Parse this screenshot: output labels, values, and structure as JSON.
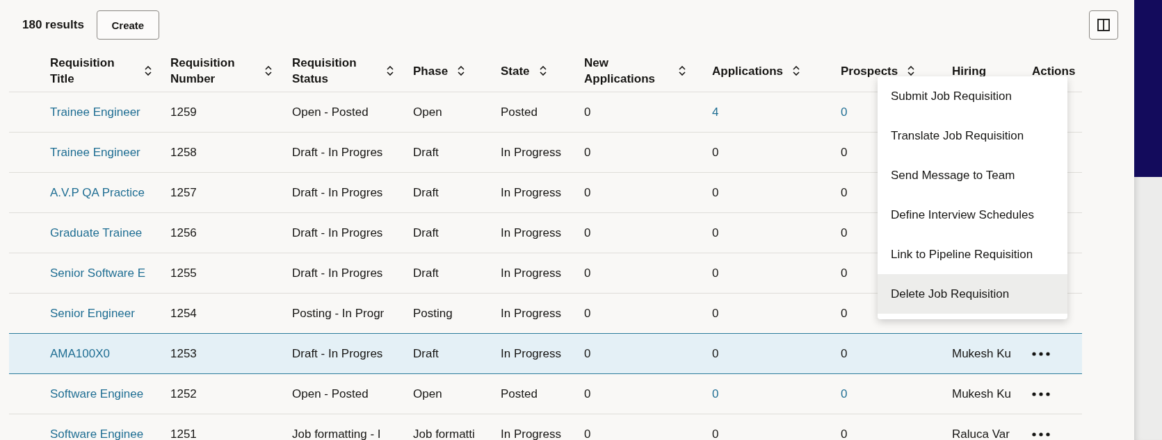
{
  "results_count": "180 results",
  "create_button": "Create",
  "columns": [
    {
      "label": "Requisition Title",
      "sortable": true
    },
    {
      "label": "Requisition Number",
      "sortable": true
    },
    {
      "label": "Requisition Status",
      "sortable": true
    },
    {
      "label": "Phase",
      "sortable": true
    },
    {
      "label": "State",
      "sortable": true
    },
    {
      "label": "New Applications",
      "sortable": true
    },
    {
      "label": "Applications",
      "sortable": true
    },
    {
      "label": "Prospects",
      "sortable": true
    },
    {
      "label": "Hiring",
      "sortable": false
    },
    {
      "label": "Actions",
      "sortable": false
    }
  ],
  "rows": [
    {
      "title": "Trainee Engineer",
      "number": "1259",
      "status": "Open - Posted",
      "phase": "Open",
      "state": "Posted",
      "new_applications": "0",
      "applications": {
        "text": "4",
        "link": true
      },
      "prospects": {
        "text": "0",
        "link": true
      },
      "selected": false
    },
    {
      "title": "Trainee Engineer",
      "number": "1258",
      "status": "Draft - In Progres",
      "phase": "Draft",
      "state": "In Progress",
      "new_applications": "0",
      "applications": {
        "text": "0",
        "link": false
      },
      "prospects": {
        "text": "0",
        "link": false
      },
      "selected": false
    },
    {
      "title": "A.V.P QA Practice",
      "number": "1257",
      "status": "Draft - In Progres",
      "phase": "Draft",
      "state": "In Progress",
      "new_applications": "0",
      "applications": {
        "text": "0",
        "link": false
      },
      "prospects": {
        "text": "0",
        "link": false
      },
      "selected": false
    },
    {
      "title": "Graduate Trainee",
      "number": "1256",
      "status": "Draft - In Progres",
      "phase": "Draft",
      "state": "In Progress",
      "new_applications": "0",
      "applications": {
        "text": "0",
        "link": false
      },
      "prospects": {
        "text": "0",
        "link": false
      },
      "selected": false
    },
    {
      "title": "Senior Software E",
      "number": "1255",
      "status": "Draft - In Progres",
      "phase": "Draft",
      "state": "In Progress",
      "new_applications": "0",
      "applications": {
        "text": "0",
        "link": false
      },
      "prospects": {
        "text": "0",
        "link": false
      },
      "selected": false
    },
    {
      "title": "Senior Engineer",
      "number": "1254",
      "status": "Posting - In Progr",
      "phase": "Posting",
      "state": "In Progress",
      "new_applications": "0",
      "applications": {
        "text": "0",
        "link": false
      },
      "prospects": {
        "text": "0",
        "link": false
      },
      "selected": false
    },
    {
      "title": "AMA100X0",
      "number": "1253",
      "status": "Draft - In Progres",
      "phase": "Draft",
      "state": "In Progress",
      "new_applications": "0",
      "applications": {
        "text": "0",
        "link": false
      },
      "prospects": {
        "text": "0",
        "link": false
      },
      "hiring_manager": "Mukesh Ku",
      "actions_button": true,
      "selected": true
    },
    {
      "title": "Software Enginee",
      "number": "1252",
      "status": "Open - Posted",
      "phase": "Open",
      "state": "Posted",
      "new_applications": "0",
      "applications": {
        "text": "0",
        "link": true
      },
      "prospects": {
        "text": "0",
        "link": true
      },
      "hiring_manager": "Mukesh Ku",
      "actions_button": true,
      "selected": false
    },
    {
      "title": "Software Enginee",
      "number": "1251",
      "status": "Job formatting - I",
      "phase": "Job formatti",
      "state": "In Progress",
      "new_applications": "0",
      "applications": {
        "text": "0",
        "link": false
      },
      "prospects": {
        "text": "0",
        "link": false
      },
      "hiring_manager": "Raluca Var",
      "actions_button": true,
      "selected": false
    }
  ],
  "actions_menu": [
    {
      "label": "Submit Job Requisition",
      "selected": false
    },
    {
      "label": "Translate Job Requisition",
      "selected": false
    },
    {
      "label": "Send Message to Team",
      "selected": false
    },
    {
      "label": "Define Interview Schedules",
      "selected": false
    },
    {
      "label": "Link to Pipeline Requisition",
      "selected": false
    },
    {
      "label": "Delete Job Requisition",
      "selected": true
    }
  ]
}
